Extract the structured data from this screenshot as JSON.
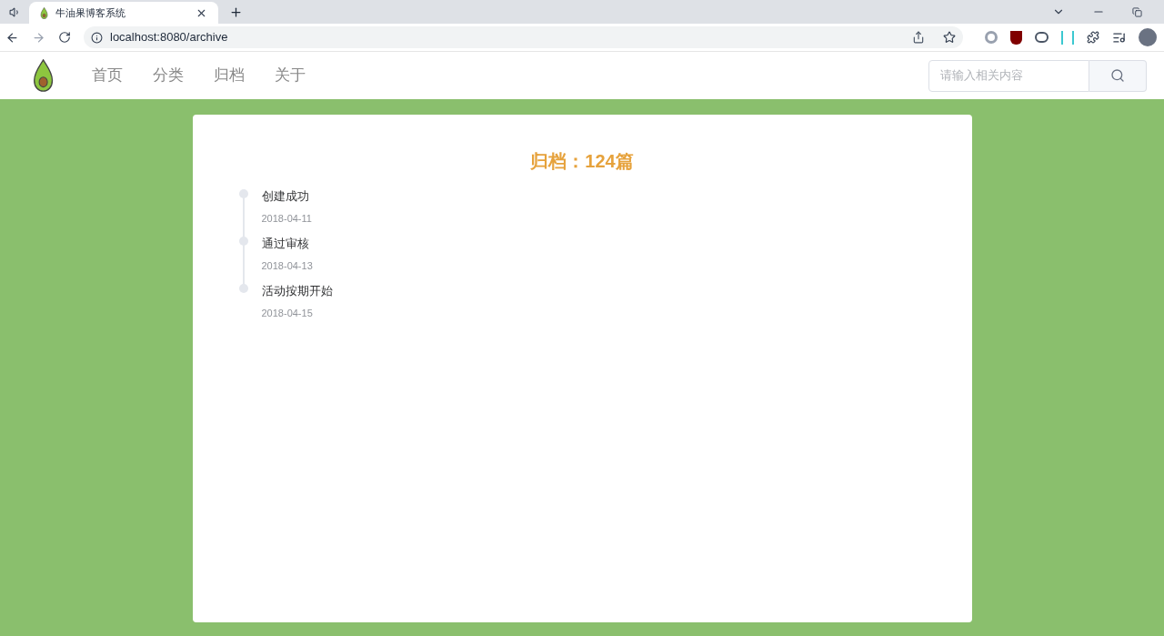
{
  "browser": {
    "tab_title": "牛油果博客系统",
    "url": "localhost:8080/archive"
  },
  "nav": {
    "items": [
      "首页",
      "分类",
      "归档",
      "关于"
    ],
    "search": {
      "placeholder": "请输入相关内容"
    }
  },
  "archive": {
    "title": "归档：124篇",
    "events": [
      {
        "title": "创建成功",
        "date": "2018-04-11"
      },
      {
        "title": "通过审核",
        "date": "2018-04-13"
      },
      {
        "title": "活动按期开始",
        "date": "2018-04-15"
      }
    ]
  }
}
